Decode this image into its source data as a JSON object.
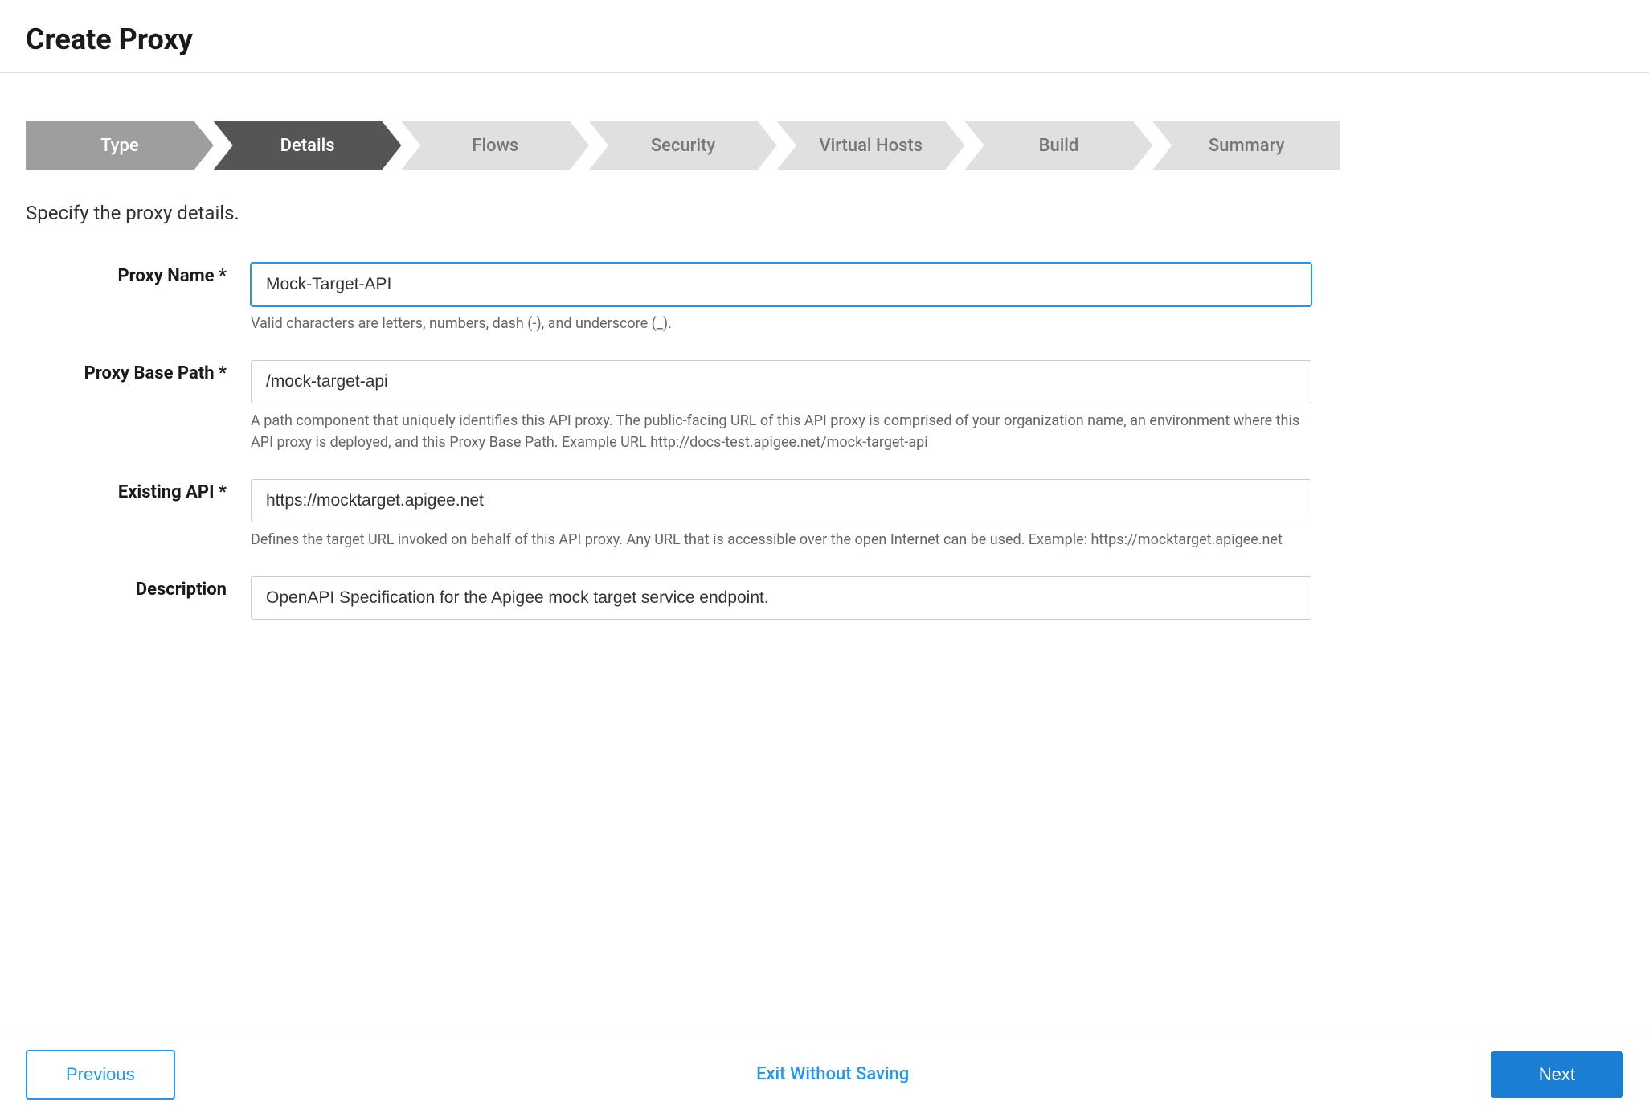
{
  "page": {
    "title": "Create Proxy"
  },
  "stepper": {
    "steps": [
      {
        "id": "type",
        "label": "Type",
        "state": "completed"
      },
      {
        "id": "details",
        "label": "Details",
        "state": "active"
      },
      {
        "id": "flows",
        "label": "Flows",
        "state": "inactive"
      },
      {
        "id": "security",
        "label": "Security",
        "state": "inactive"
      },
      {
        "id": "virtual-hosts",
        "label": "Virtual Hosts",
        "state": "inactive"
      },
      {
        "id": "build",
        "label": "Build",
        "state": "inactive"
      },
      {
        "id": "summary",
        "label": "Summary",
        "state": "inactive"
      }
    ]
  },
  "form": {
    "subtitle": "Specify the proxy details.",
    "fields": {
      "proxy_name": {
        "label": "Proxy Name *",
        "value": "Mock-Target-API",
        "hint": "Valid characters are letters, numbers, dash (-), and underscore (_)."
      },
      "proxy_base_path": {
        "label": "Proxy Base Path *",
        "value": "/mock-target-api",
        "hint": "A path component that uniquely identifies this API proxy. The public-facing URL of this API proxy is comprised of your organization name, an environment where this API proxy is deployed, and this Proxy Base Path. Example URL http://docs-test.apigee.net/mock-target-api"
      },
      "existing_api": {
        "label": "Existing API *",
        "value": "https://mocktarget.apigee.net",
        "hint": "Defines the target URL invoked on behalf of this API proxy. Any URL that is accessible over the open Internet can be used. Example: https://mocktarget.apigee.net"
      },
      "description": {
        "label": "Description",
        "value": "OpenAPI Specification for the Apigee mock target service endpoint.",
        "hint": ""
      }
    }
  },
  "buttons": {
    "previous": "Previous",
    "exit": "Exit Without Saving",
    "next": "Next"
  }
}
